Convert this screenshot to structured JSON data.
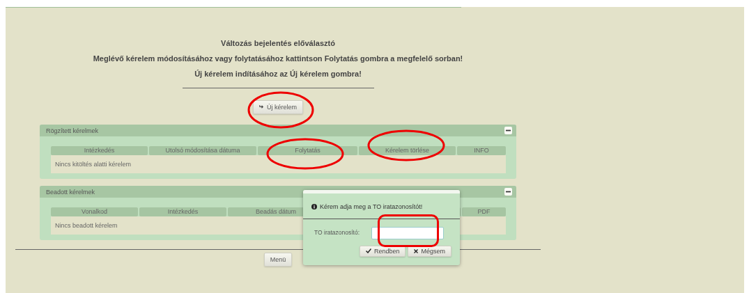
{
  "heading": {
    "title": "Változás bejelentés előválasztó",
    "lines": [
      "Meglévő kérelem módosításához vagy folytatásához kattintson Folytatás gombra a megfelelő sorban!",
      "Új kérelem indításához az Új kérelem gombra!"
    ]
  },
  "new_button": {
    "label": "Új kérelem",
    "circled": true
  },
  "panels": [
    {
      "title": "Rögzített kérelmek",
      "expanded": true,
      "columns": [
        {
          "label": "Intézkedés",
          "circled": false
        },
        {
          "label": "Utolsó módosítása dátuma",
          "circled": false
        },
        {
          "label": "Folytatás",
          "circled": true
        },
        {
          "label": "Kérelem törlése",
          "circled": true
        },
        {
          "label": "INFO",
          "circled": false
        }
      ],
      "empty_text": "Nincs kitöltés alatti kérelem"
    },
    {
      "title": "Beadott kérelmek",
      "expanded": true,
      "columns": [
        {
          "label": "Vonalkod",
          "circled": false
        },
        {
          "label": "Intézkedés",
          "circled": false
        },
        {
          "label": "Beadás dátum",
          "circled": false
        },
        {
          "label": "PDF",
          "circled": false
        }
      ],
      "empty_text": "Nincs beadott kérelem"
    }
  ],
  "menu_button": {
    "label": "Menü"
  },
  "dialog": {
    "message": "Kérem adja meg a TO iratazonosítót!",
    "field_label": "TO iratazonosító:",
    "field_circled": true,
    "buttons": [
      {
        "label": "Rendben",
        "kind": "ok"
      },
      {
        "label": "Mégsem",
        "kind": "cancel"
      }
    ]
  }
}
